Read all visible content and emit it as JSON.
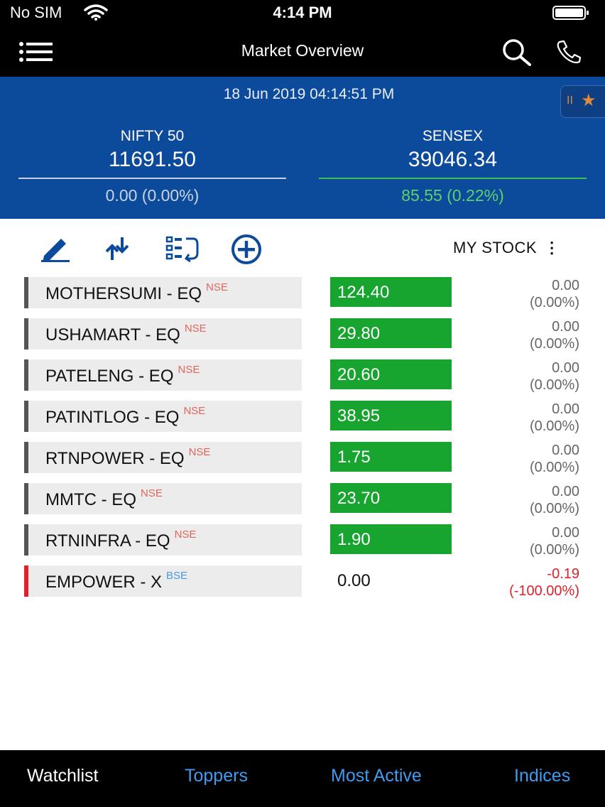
{
  "status_bar": {
    "carrier": "No SIM",
    "time": "4:14 PM"
  },
  "nav": {
    "title": "Market Overview"
  },
  "market": {
    "datetime": "18 Jun 2019 04:14:51 PM",
    "indices": [
      {
        "name": "NIFTY 50",
        "value": "11691.50",
        "change": "0.00 (0.00%)",
        "change_color": "#c9d3e3",
        "line_color": "#c9d3e3"
      },
      {
        "name": "SENSEX",
        "value": "39046.34",
        "change": "85.55 (0.22%)",
        "change_color": "#5fd06a",
        "line_color": "#3fbf4d"
      }
    ]
  },
  "toolbar": {
    "mystock_label": "MY STOCK",
    "menu_glyph": "⋮"
  },
  "watchlist": [
    {
      "symbol": "MOTHERSUMI  - EQ",
      "exchange": "NSE",
      "price": "124.40",
      "change": "0.00",
      "change_pct": "(0.00%)",
      "status": "flat"
    },
    {
      "symbol": "USHAMART  - EQ",
      "exchange": "NSE",
      "price": "29.80",
      "change": "0.00",
      "change_pct": "(0.00%)",
      "status": "flat"
    },
    {
      "symbol": "PATELENG  - EQ",
      "exchange": "NSE",
      "price": "20.60",
      "change": "0.00",
      "change_pct": "(0.00%)",
      "status": "flat"
    },
    {
      "symbol": "PATINTLOG  - EQ",
      "exchange": "NSE",
      "price": "38.95",
      "change": "0.00",
      "change_pct": "(0.00%)",
      "status": "flat"
    },
    {
      "symbol": "RTNPOWER  - EQ",
      "exchange": "NSE",
      "price": "1.75",
      "change": "0.00",
      "change_pct": "(0.00%)",
      "status": "flat"
    },
    {
      "symbol": "MMTC  - EQ",
      "exchange": "NSE",
      "price": "23.70",
      "change": "0.00",
      "change_pct": "(0.00%)",
      "status": "flat"
    },
    {
      "symbol": "RTNINFRA  - EQ",
      "exchange": "NSE",
      "price": "1.90",
      "change": "0.00",
      "change_pct": "(0.00%)",
      "status": "flat"
    },
    {
      "symbol": "EMPOWER  - X",
      "exchange": "BSE",
      "price": "0.00",
      "change": "-0.19",
      "change_pct": "(-100.00%)",
      "status": "down"
    }
  ],
  "colors": {
    "header_blue": "#0c4a9c",
    "price_green": "#17a42f",
    "nse_tag": "#e0665a",
    "bse_tag": "#4a9be0",
    "down_red": "#e0202a",
    "down_bar": "#e0202a",
    "flat_bar": "#555555",
    "tab_active": "#ffffff",
    "tab_inactive": "#3e9bf0",
    "tool_blue": "#0c4a9c"
  },
  "bottom_tabs": [
    {
      "label": "Watchlist",
      "active": true
    },
    {
      "label": "Toppers",
      "active": false
    },
    {
      "label": "Most Active",
      "active": false
    },
    {
      "label": "Indices",
      "active": false
    }
  ],
  "icons": [
    "hamburger-icon",
    "search-icon",
    "phone-icon",
    "pencil-icon",
    "sort-arrows-icon",
    "reorder-icon",
    "add-circle-icon",
    "star-icon",
    "wifi-icon",
    "battery-icon"
  ]
}
